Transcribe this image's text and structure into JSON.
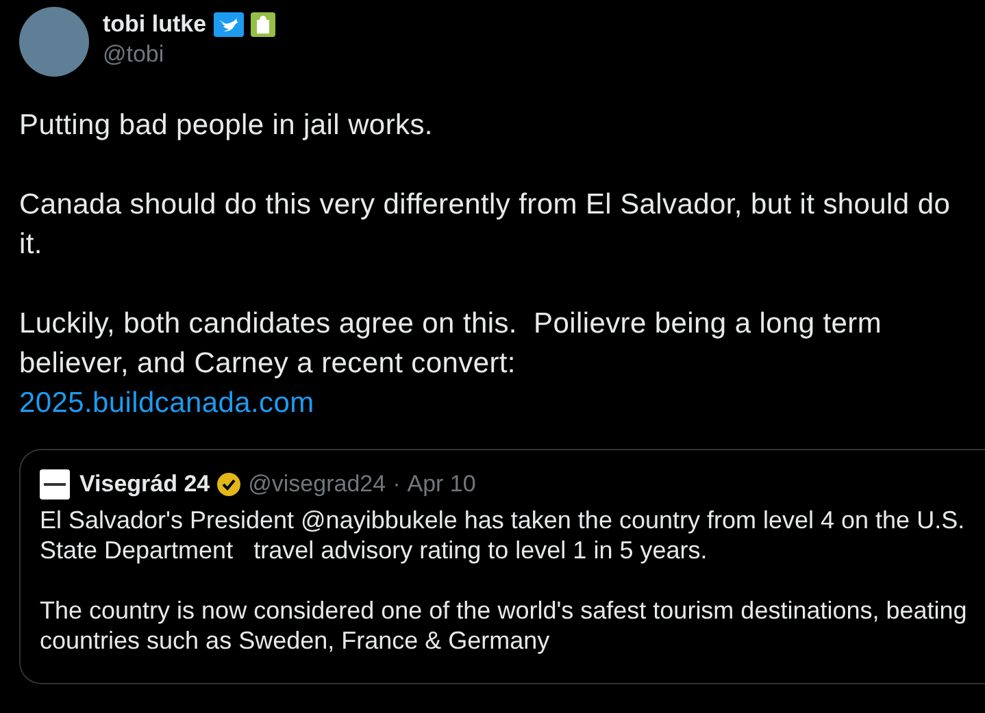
{
  "author": {
    "name": "tobi lutke",
    "handle": "@tobi"
  },
  "paragraphs": [
    "Putting bad people in jail works.",
    "Canada should do this very differently from El Salvador, but it should do it.",
    "Luckily, both candidates agree on this.  Poilievre being a long term believer, and Carney a recent convert:"
  ],
  "link": "2025.buildcanada.com",
  "quote": {
    "name": "Visegrád 24",
    "handle": "@visegrad24",
    "separator": "·",
    "date": "Apr 10",
    "paragraphs": [
      "El Salvador's President @nayibbukele has taken the country from level 4 on the U.S. State Department   travel advisory rating to level 1 in 5 years.",
      "The country is now considered one of the world's safest tourism destinations, beating countries such as Sweden, France & Germany"
    ]
  }
}
